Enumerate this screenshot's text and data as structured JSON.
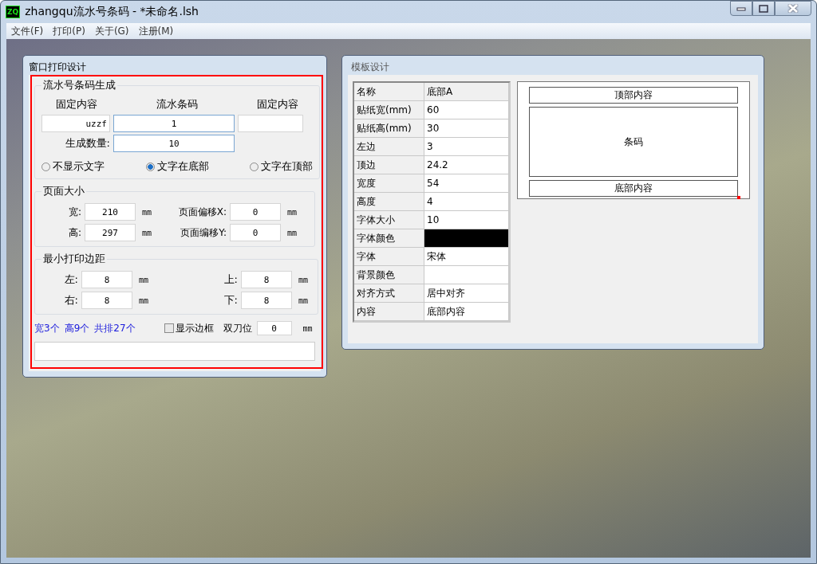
{
  "window": {
    "title": "zhangqu流水号条码 - *未命名.lsh",
    "logo": "ZQ"
  },
  "menu": [
    "文件(F)",
    "打印(P)",
    "关于(G)",
    "注册(M)"
  ],
  "print_window": {
    "title": "窗口打印设计",
    "serial": {
      "legend": "流水号条码生成",
      "headers": [
        "固定内容",
        "流水条码",
        "固定内容"
      ],
      "prefix": "uzzf",
      "serial_value": "1",
      "count_label": "生成数量:",
      "count_value": "10",
      "radios": [
        {
          "label": "不显示文字",
          "selected": false
        },
        {
          "label": "文字在底部",
          "selected": true
        },
        {
          "label": "文字在顶部",
          "selected": false
        }
      ]
    },
    "page": {
      "legend": "页面大小",
      "fields": [
        {
          "label": "宽:",
          "value": "210",
          "unit": "mm"
        },
        {
          "label": "页面偏移X:",
          "value": "0",
          "unit": "mm"
        },
        {
          "label": "高:",
          "value": "297",
          "unit": "mm"
        },
        {
          "label": "页面编移Y:",
          "value": "0",
          "unit": "mm"
        }
      ]
    },
    "margins": {
      "legend": "最小打印边距",
      "fields": [
        {
          "label": "左:",
          "value": "8",
          "unit": "mm"
        },
        {
          "label": "上:",
          "value": "8",
          "unit": "mm"
        },
        {
          "label": "右:",
          "value": "8",
          "unit": "mm"
        },
        {
          "label": "下:",
          "value": "8",
          "unit": "mm"
        }
      ]
    },
    "summary": [
      "宽3个",
      "高9个",
      "共排27个"
    ],
    "show_border": {
      "label": "显示边框",
      "checked": false
    },
    "double_knife": {
      "label": "双刀位",
      "value": "0",
      "unit": "mm"
    }
  },
  "template_window": {
    "title": "模板设计",
    "properties": [
      {
        "kind": "text",
        "name": "名称",
        "value": "底部A"
      },
      {
        "kind": "text",
        "name": "贴纸宽(mm)",
        "value": "60"
      },
      {
        "kind": "text",
        "name": "贴纸高(mm)",
        "value": "30"
      },
      {
        "kind": "text",
        "name": "左边",
        "value": "3"
      },
      {
        "kind": "text",
        "name": "顶边",
        "value": "24.2"
      },
      {
        "kind": "text",
        "name": "宽度",
        "value": "54"
      },
      {
        "kind": "text",
        "name": "高度",
        "value": "4"
      },
      {
        "kind": "text",
        "name": "字体大小",
        "value": "10"
      },
      {
        "kind": "color",
        "name": "字体颜色",
        "color": "#000000"
      },
      {
        "kind": "text",
        "name": "字体",
        "value": "宋体"
      },
      {
        "kind": "color",
        "name": "背景颜色",
        "color": "#ffffff"
      },
      {
        "kind": "text",
        "name": "对齐方式",
        "value": "居中对齐"
      },
      {
        "kind": "text",
        "name": "内容",
        "value": "底部内容"
      }
    ],
    "preview": {
      "top": "顶部内容",
      "barcode": "条码",
      "bottom": "底部内容"
    }
  }
}
